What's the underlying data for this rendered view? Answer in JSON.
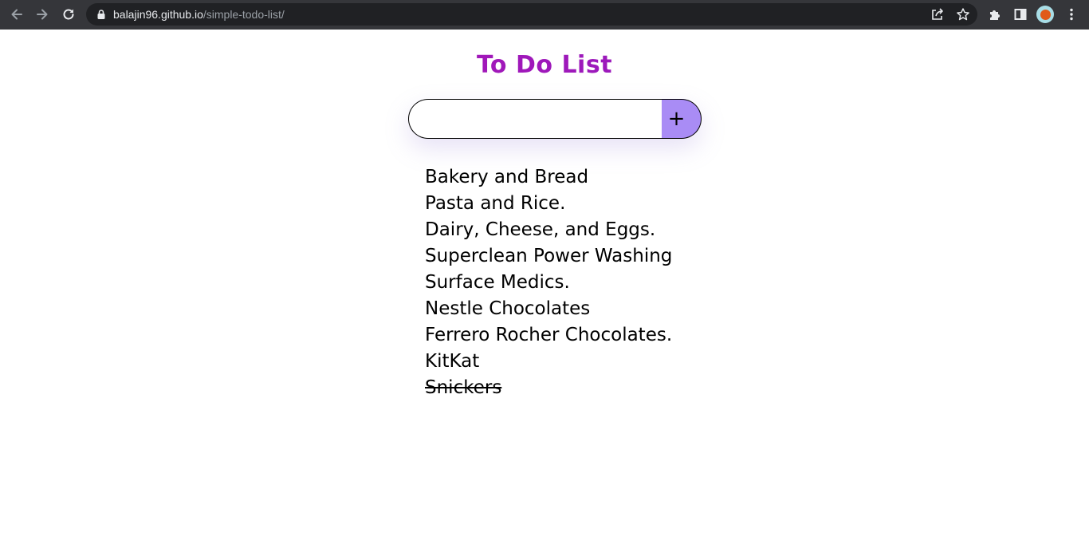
{
  "browser": {
    "url_host": "balajin96.github.io",
    "url_path": "/simple-todo-list/",
    "icons": [
      "back-icon",
      "forward-icon",
      "reload-icon",
      "lock-icon",
      "share-icon",
      "star-icon",
      "extensions-icon",
      "side-panel-icon",
      "profile-avatar",
      "menu-icon"
    ]
  },
  "page": {
    "title": "To Do List",
    "input": {
      "value": "",
      "placeholder": ""
    },
    "add_button_label": "+",
    "colors": {
      "title_start": "#b312b0",
      "title_end": "#8a1fc4",
      "add_button": "#a98cf5"
    }
  },
  "todos": [
    {
      "text": "Bakery and Bread",
      "done": false
    },
    {
      "text": "Pasta and Rice.",
      "done": false
    },
    {
      "text": "Dairy, Cheese, and Eggs.",
      "done": false
    },
    {
      "text": "Superclean Power Washing",
      "done": false
    },
    {
      "text": "Surface Medics.",
      "done": false
    },
    {
      "text": "Nestle Chocolates",
      "done": false
    },
    {
      "text": "Ferrero Rocher Chocolates.",
      "done": false
    },
    {
      "text": "KitKat",
      "done": false
    },
    {
      "text": "Snickers",
      "done": true
    }
  ]
}
